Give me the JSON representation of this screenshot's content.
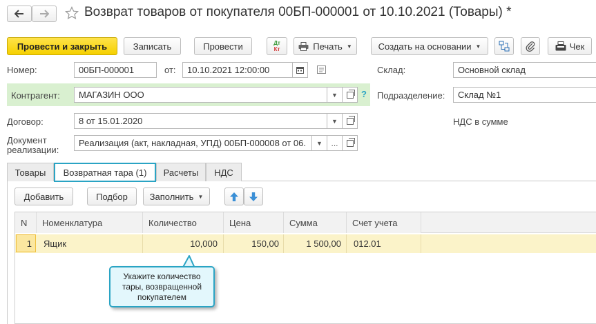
{
  "window": {
    "title": "Возврат товаров от покупателя 00БП-000001 от 10.10.2021 (Товары) *"
  },
  "toolbar": {
    "post_close": "Провести и закрыть",
    "save": "Записать",
    "post": "Провести",
    "dtkt_top": "Дт",
    "dtkt_bottom": "Кт",
    "print": "Печать",
    "create_based": "Создать на основании",
    "check": "Чек"
  },
  "form": {
    "number_label": "Номер:",
    "number_value": "00БП-000001",
    "date_label": "от:",
    "date_value": "10.10.2021 12:00:00",
    "warehouse_label": "Склад:",
    "warehouse_value": "Основной склад",
    "counterparty_label": "Контрагент:",
    "counterparty_value": "МАГАЗИН ООО",
    "help_mark": "?",
    "subdivision_label": "Подразделение:",
    "subdivision_value": "Склад №1",
    "contract_label": "Договор:",
    "contract_value": "8 от 15.01.2020",
    "vat_text": "НДС в сумме",
    "sale_doc_label_line1": "Документ",
    "sale_doc_label_line2": "реализации:",
    "sale_doc_value": "Реализация (акт, накладная, УПД) 00БП-000008 от 06.",
    "ellipsis": "..."
  },
  "tabs": [
    {
      "label": "Товары",
      "active": false
    },
    {
      "label": "Возвратная тара (1)",
      "active": true
    },
    {
      "label": "Расчеты",
      "active": false
    },
    {
      "label": "НДС",
      "active": false
    }
  ],
  "table_toolbar": {
    "add": "Добавить",
    "select": "Подбор",
    "fill": "Заполнить"
  },
  "table": {
    "columns": [
      "N",
      "Номенклатура",
      "Количество",
      "Цена",
      "Сумма",
      "Счет учета"
    ],
    "rows": [
      {
        "n": "1",
        "item": "Ящик",
        "qty": "10,000",
        "price": "150,00",
        "sum": "1 500,00",
        "account": "012.01"
      }
    ]
  },
  "callout": {
    "line1": "Укажите количество",
    "line2": "тары, возвращенной",
    "line3": "покупателем"
  },
  "colors": {
    "primary_button": "#f5d000",
    "active_tab_border": "#2aa4c4",
    "counterparty_highlight": "#d9f0d0",
    "selected_row": "#fbf3c9",
    "callout_bg": "#e3f7fc",
    "callout_border": "#2aa4c4",
    "arrow_blue": "#3a8fd6"
  }
}
